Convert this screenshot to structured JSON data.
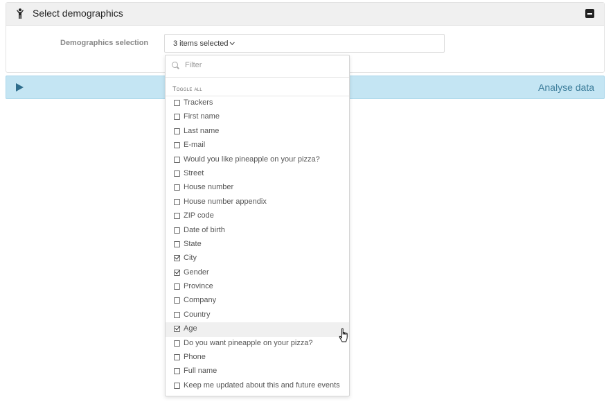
{
  "panel": {
    "title": "Select demographics",
    "icon": "person-icon",
    "collapse_icon": "minus-square-icon"
  },
  "field": {
    "label": "Demographics selection",
    "selected_text": "3 items selected"
  },
  "analyse": {
    "label": "Analyse data",
    "icon": "play-icon"
  },
  "dropdown": {
    "filter_placeholder": "Filter",
    "toggle_all": "Toggle all",
    "options": [
      {
        "label": "Trackers",
        "checked": false
      },
      {
        "label": "First name",
        "checked": false
      },
      {
        "label": "Last name",
        "checked": false
      },
      {
        "label": "E-mail",
        "checked": false
      },
      {
        "label": "Would you like pineapple on your pizza?",
        "checked": false
      },
      {
        "label": "Street",
        "checked": false
      },
      {
        "label": "House number",
        "checked": false
      },
      {
        "label": "House number appendix",
        "checked": false
      },
      {
        "label": "ZIP code",
        "checked": false
      },
      {
        "label": "Date of birth",
        "checked": false
      },
      {
        "label": "State",
        "checked": false
      },
      {
        "label": "City",
        "checked": true
      },
      {
        "label": "Gender",
        "checked": true
      },
      {
        "label": "Province",
        "checked": false
      },
      {
        "label": "Company",
        "checked": false
      },
      {
        "label": "Country",
        "checked": false
      },
      {
        "label": "Age",
        "checked": true,
        "hover": true
      },
      {
        "label": "Do you want pineapple on your pizza?",
        "checked": false
      },
      {
        "label": "Phone",
        "checked": false
      },
      {
        "label": "Full name",
        "checked": false
      },
      {
        "label": "Keep me updated about this and future events",
        "checked": false
      }
    ]
  },
  "colors": {
    "analyse_bg": "#c4e5f3",
    "analyse_text": "#3b7c9a",
    "header_bg": "#f0f0f0"
  }
}
